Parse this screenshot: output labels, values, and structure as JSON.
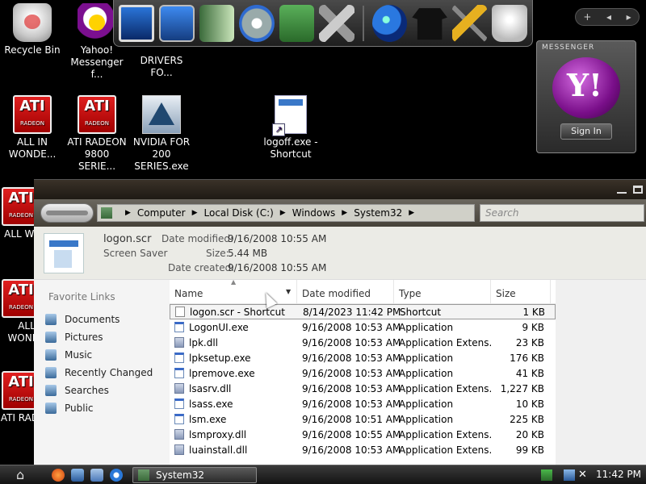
{
  "desktop": {
    "icons": [
      {
        "id": "recycle-bin",
        "label": "Recycle Bin"
      },
      {
        "id": "yahoo",
        "label": "Yahoo! Messenger f..."
      },
      {
        "id": "ati-allinwonder",
        "label": "ALL IN WONDE..."
      },
      {
        "id": "ati-radeon-9800",
        "label": "ATI RADEON 9800 SERIE..."
      },
      {
        "id": "nvidia",
        "label": "NVIDIA FOR 200 SERIES.exe"
      },
      {
        "id": "logoff",
        "label": "logoff.exe - Shortcut"
      },
      {
        "id": "partial-drivers",
        "label": "DRIVERS FO..."
      },
      {
        "id": "left-1",
        "label": "ALL WON"
      },
      {
        "id": "left-2",
        "label": "ALL WONDE"
      },
      {
        "id": "left-3",
        "label": "ATI RADEO"
      }
    ]
  },
  "dock": {
    "icons": [
      "monitor-icon",
      "display-icon",
      "documents-icon",
      "media-icon",
      "pictures-icon",
      "tools-icon",
      "globe-icon",
      "tshirt-icon",
      "hammer-icon",
      "trash-icon"
    ]
  },
  "mini_ctrl": {
    "plus": "+",
    "prev": "◂",
    "next": "▸"
  },
  "messenger": {
    "title": "MESSENGER",
    "signin_label": "Sign In",
    "accent": "#7a0f8a"
  },
  "explorer": {
    "breadcrumb": [
      "Computer",
      "Local Disk (C:)",
      "Windows",
      "System32"
    ],
    "search_placeholder": "Search",
    "details": {
      "filename": "logon.scr",
      "filetype": "Screen Saver",
      "modified_label": "Date modified:",
      "modified_value": "9/16/2008 10:55 AM",
      "size_label": "Size:",
      "size_value": "5.44 MB",
      "created_label": "Date created:",
      "created_value": "9/16/2008 10:55 AM"
    },
    "favorites_title": "Favorite Links",
    "favorites": [
      "Documents",
      "Pictures",
      "Music",
      "Recently Changed",
      "Searches",
      "Public"
    ],
    "columns": {
      "name": "Name",
      "date": "Date modified",
      "type": "Type",
      "size": "Size"
    },
    "files": [
      {
        "name": "logon.scr - Shortcut",
        "date": "8/14/2023 11:42 PM",
        "type": "Shortcut",
        "size": "1 KB",
        "icon": "lnk",
        "selected": true
      },
      {
        "name": "LogonUI.exe",
        "date": "9/16/2008 10:53 AM",
        "type": "Application",
        "size": "9 KB",
        "icon": "app"
      },
      {
        "name": "lpk.dll",
        "date": "9/16/2008 10:53 AM",
        "type": "Application Extens...",
        "size": "23 KB",
        "icon": "dll"
      },
      {
        "name": "lpksetup.exe",
        "date": "9/16/2008 10:53 AM",
        "type": "Application",
        "size": "176 KB",
        "icon": "app"
      },
      {
        "name": "lpremove.exe",
        "date": "9/16/2008 10:53 AM",
        "type": "Application",
        "size": "41 KB",
        "icon": "app"
      },
      {
        "name": "lsasrv.dll",
        "date": "9/16/2008 10:53 AM",
        "type": "Application Extens...",
        "size": "1,227 KB",
        "icon": "dll"
      },
      {
        "name": "lsass.exe",
        "date": "9/16/2008 10:53 AM",
        "type": "Application",
        "size": "10 KB",
        "icon": "app"
      },
      {
        "name": "lsm.exe",
        "date": "9/16/2008 10:51 AM",
        "type": "Application",
        "size": "225 KB",
        "icon": "app"
      },
      {
        "name": "lsmproxy.dll",
        "date": "9/16/2008 10:55 AM",
        "type": "Application Extens...",
        "size": "20 KB",
        "icon": "dll"
      },
      {
        "name": "luainstall.dll",
        "date": "9/16/2008 10:53 AM",
        "type": "Application Extens...",
        "size": "99 KB",
        "icon": "dll"
      }
    ]
  },
  "taskbar": {
    "task_label": "System32",
    "clock": "11:42 PM"
  }
}
